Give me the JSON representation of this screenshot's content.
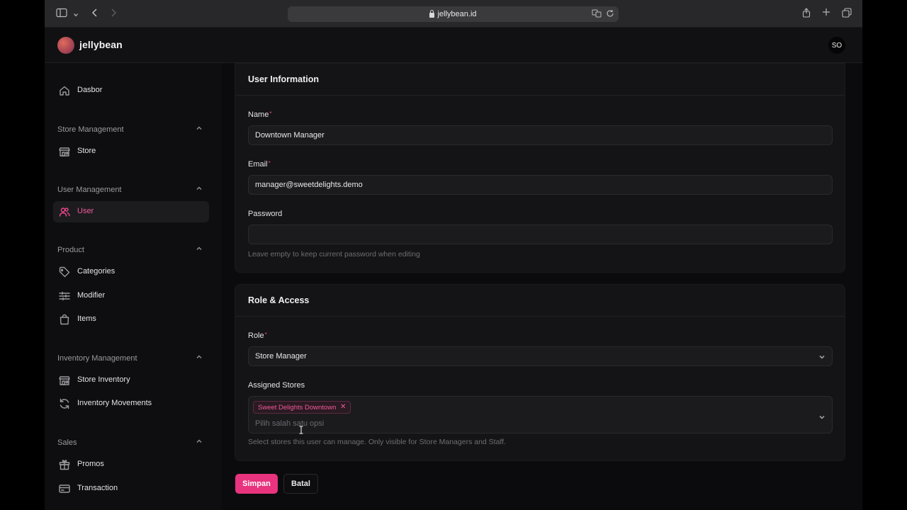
{
  "browser": {
    "url": "jellybean.id"
  },
  "header": {
    "brand": "jellybean",
    "avatar_initials": "SO"
  },
  "sidebar": {
    "items": [
      {
        "label": "Dasbor",
        "icon": "home-icon"
      },
      {
        "group": "Store Management"
      },
      {
        "label": "Store",
        "icon": "store-icon"
      },
      {
        "group": "User Management"
      },
      {
        "label": "User",
        "icon": "users-icon",
        "active": true
      },
      {
        "group": "Product"
      },
      {
        "label": "Categories",
        "icon": "tag-icon"
      },
      {
        "label": "Modifier",
        "icon": "sliders-icon"
      },
      {
        "label": "Items",
        "icon": "bag-icon"
      },
      {
        "group": "Inventory Management"
      },
      {
        "label": "Store Inventory",
        "icon": "store-icon"
      },
      {
        "label": "Inventory Movements",
        "icon": "refresh-icon"
      },
      {
        "group": "Sales"
      },
      {
        "label": "Promos",
        "icon": "gift-icon"
      },
      {
        "label": "Transaction",
        "icon": "credit-card-icon"
      }
    ]
  },
  "user_info": {
    "title": "User Information",
    "name_label": "Name",
    "name_value": "Downtown Manager",
    "email_label": "Email",
    "email_value": "manager@sweetdelights.demo",
    "password_label": "Password",
    "password_value": "",
    "password_hint": "Leave empty to keep current password when editing"
  },
  "role_access": {
    "title": "Role & Access",
    "role_label": "Role",
    "role_value": "Store Manager",
    "stores_label": "Assigned Stores",
    "stores_selected": [
      "Sweet Delights Downtown"
    ],
    "stores_placeholder": "Pilih salah satu opsi",
    "stores_hint": "Select stores this user can manage. Only visible for Store Managers and Staff."
  },
  "actions": {
    "save_label": "Simpan",
    "cancel_label": "Batal"
  },
  "colors": {
    "accent": "#e8337e",
    "background": "#0b0b0d"
  }
}
